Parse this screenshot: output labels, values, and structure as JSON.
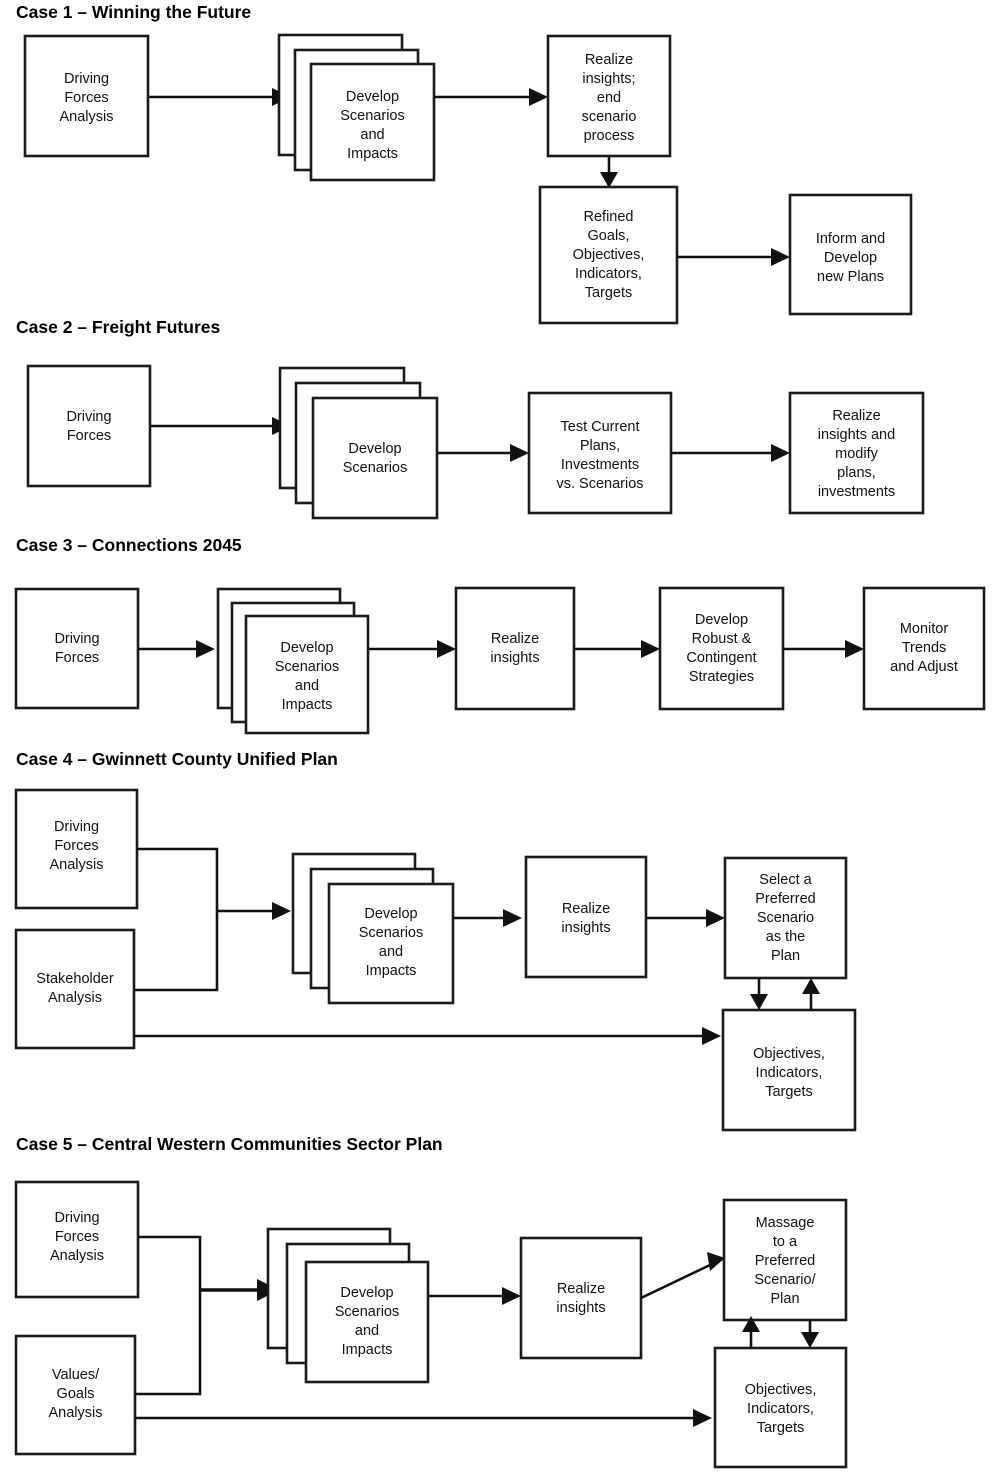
{
  "document": {
    "title": "Scenario Planning Case Process Diagrams",
    "background_color": "#ffffff",
    "line_color": "#111111"
  },
  "cases": [
    {
      "id": "case-1",
      "title": "Case 1 – Winning the Future",
      "nodes": [
        {
          "id": "c1-driving-forces-analysis",
          "label": "Driving\nForces\nAnalysis",
          "stacked": false
        },
        {
          "id": "c1-develop-scenarios-impacts",
          "label": "Develop\nScenarios\nand\nImpacts",
          "stacked": true
        },
        {
          "id": "c1-realize-insights-end",
          "label": "Realize\ninsights;\nend\nscenario\nprocess",
          "stacked": false
        },
        {
          "id": "c1-refined-goals",
          "label": "Refined\nGoals,\nObjectives,\nIndicators,\nTargets",
          "stacked": false
        },
        {
          "id": "c1-inform-develop-plans",
          "label": "Inform and\nDevelop\nnew Plans",
          "stacked": false
        }
      ],
      "edges": [
        {
          "from": "c1-driving-forces-analysis",
          "to": "c1-develop-scenarios-impacts",
          "kind": "arrow-right"
        },
        {
          "from": "c1-develop-scenarios-impacts",
          "to": "c1-realize-insights-end",
          "kind": "arrow-right"
        },
        {
          "from": "c1-realize-insights-end",
          "to": "c1-refined-goals",
          "kind": "arrow-down"
        },
        {
          "from": "c1-refined-goals",
          "to": "c1-inform-develop-plans",
          "kind": "arrow-right"
        }
      ]
    },
    {
      "id": "case-2",
      "title": "Case 2 – Freight Futures",
      "nodes": [
        {
          "id": "c2-driving-forces",
          "label": "Driving\nForces",
          "stacked": false
        },
        {
          "id": "c2-develop-scenarios",
          "label": "Develop\nScenarios",
          "stacked": true
        },
        {
          "id": "c2-test-current-plans",
          "label": "Test Current\nPlans,\nInvestments\nvs. Scenarios",
          "stacked": false
        },
        {
          "id": "c2-realize-insights-modify",
          "label": "Realize\ninsights and\nmodify\nplans,\ninvestments",
          "stacked": false
        }
      ],
      "edges": [
        {
          "from": "c2-driving-forces",
          "to": "c2-develop-scenarios",
          "kind": "arrow-right"
        },
        {
          "from": "c2-develop-scenarios",
          "to": "c2-test-current-plans",
          "kind": "arrow-right"
        },
        {
          "from": "c2-test-current-plans",
          "to": "c2-realize-insights-modify",
          "kind": "arrow-right"
        }
      ]
    },
    {
      "id": "case-3",
      "title": "Case 3 – Connections 2045",
      "nodes": [
        {
          "id": "c3-driving-forces",
          "label": "Driving\nForces",
          "stacked": false
        },
        {
          "id": "c3-develop-scenarios-impacts",
          "label": "Develop\nScenarios\nand\nImpacts",
          "stacked": true
        },
        {
          "id": "c3-realize-insights",
          "label": "Realize\ninsights",
          "stacked": false
        },
        {
          "id": "c3-develop-robust-strategies",
          "label": "Develop\nRobust &\nContingent\nStrategies",
          "stacked": false
        },
        {
          "id": "c3-monitor-trends",
          "label": "Monitor\nTrends\nand Adjust",
          "stacked": false
        }
      ],
      "edges": [
        {
          "from": "c3-driving-forces",
          "to": "c3-develop-scenarios-impacts",
          "kind": "arrow-right"
        },
        {
          "from": "c3-develop-scenarios-impacts",
          "to": "c3-realize-insights",
          "kind": "arrow-right"
        },
        {
          "from": "c3-realize-insights",
          "to": "c3-develop-robust-strategies",
          "kind": "arrow-right"
        },
        {
          "from": "c3-develop-robust-strategies",
          "to": "c3-monitor-trends",
          "kind": "arrow-right"
        }
      ]
    },
    {
      "id": "case-4",
      "title": "Case 4 – Gwinnett County Unified Plan",
      "nodes": [
        {
          "id": "c4-driving-forces-analysis",
          "label": "Driving\nForces\nAnalysis",
          "stacked": false
        },
        {
          "id": "c4-stakeholder-analysis",
          "label": "Stakeholder\nAnalysis",
          "stacked": false
        },
        {
          "id": "c4-develop-scenarios-impacts",
          "label": "Develop\nScenarios\nand\nImpacts",
          "stacked": true
        },
        {
          "id": "c4-realize-insights",
          "label": "Realize\ninsights",
          "stacked": false
        },
        {
          "id": "c4-select-preferred-scenario",
          "label": "Select a\nPreferred\nScenario\nas the\nPlan",
          "stacked": false
        },
        {
          "id": "c4-objectives-indicators-targets",
          "label": "Objectives,\nIndicators,\nTargets",
          "stacked": false
        }
      ],
      "edges": [
        {
          "from": "c4-driving-forces-analysis",
          "to": "c4-develop-scenarios-impacts",
          "kind": "elbow-merge-arrow-right"
        },
        {
          "from": "c4-stakeholder-analysis",
          "to": "c4-develop-scenarios-impacts",
          "kind": "elbow-merge-arrow-right"
        },
        {
          "from": "c4-develop-scenarios-impacts",
          "to": "c4-realize-insights",
          "kind": "arrow-right"
        },
        {
          "from": "c4-realize-insights",
          "to": "c4-select-preferred-scenario",
          "kind": "arrow-right"
        },
        {
          "from": "c4-select-preferred-scenario",
          "to": "c4-objectives-indicators-targets",
          "kind": "arrow-down"
        },
        {
          "from": "c4-objectives-indicators-targets",
          "to": "c4-select-preferred-scenario",
          "kind": "arrow-up"
        },
        {
          "from": "c4-stakeholder-analysis",
          "to": "c4-objectives-indicators-targets",
          "kind": "arrow-right-long"
        }
      ]
    },
    {
      "id": "case-5",
      "title": "Case 5 – Central Western Communities Sector Plan",
      "nodes": [
        {
          "id": "c5-driving-forces-analysis",
          "label": "Driving\nForces\nAnalysis",
          "stacked": false
        },
        {
          "id": "c5-values-goals-analysis",
          "label": "Values/\nGoals\nAnalysis",
          "stacked": false
        },
        {
          "id": "c5-develop-scenarios-impacts",
          "label": "Develop\nScenarios\nand\nImpacts",
          "stacked": true
        },
        {
          "id": "c5-realize-insights",
          "label": "Realize\ninsights",
          "stacked": false
        },
        {
          "id": "c5-massage-preferred-scenario",
          "label": "Massage\nto a\nPreferred\nScenario/\nPlan",
          "stacked": false
        },
        {
          "id": "c5-objectives-indicators-targets",
          "label": "Objectives,\nIndicators,\nTargets",
          "stacked": false
        }
      ],
      "edges": [
        {
          "from": "c5-driving-forces-analysis",
          "to": "c5-develop-scenarios-impacts",
          "kind": "elbow-merge-arrow-right"
        },
        {
          "from": "c5-values-goals-analysis",
          "to": "c5-develop-scenarios-impacts",
          "kind": "elbow-merge-arrow-right"
        },
        {
          "from": "c5-develop-scenarios-impacts",
          "to": "c5-realize-insights",
          "kind": "arrow-right"
        },
        {
          "from": "c5-realize-insights",
          "to": "c5-massage-preferred-scenario",
          "kind": "arrow-diagonal-up-right"
        },
        {
          "from": "c5-massage-preferred-scenario",
          "to": "c5-objectives-indicators-targets",
          "kind": "arrow-down"
        },
        {
          "from": "c5-objectives-indicators-targets",
          "to": "c5-massage-preferred-scenario",
          "kind": "arrow-up"
        },
        {
          "from": "c5-values-goals-analysis",
          "to": "c5-objectives-indicators-targets",
          "kind": "arrow-right-long"
        }
      ]
    }
  ],
  "labels": {
    "c1_title": "Case 1 – Winning the Future",
    "c1_n1": "Driving",
    "c1_n1b": "Forces",
    "c1_n1c": "Analysis",
    "c1_n2": "Develop",
    "c1_n2b": "Scenarios",
    "c1_n2c": "and",
    "c1_n2d": "Impacts",
    "c1_n3": "Realize",
    "c1_n3b": "insights;",
    "c1_n3c": "end",
    "c1_n3d": "scenario",
    "c1_n3e": "process",
    "c1_n4": "Refined",
    "c1_n4b": "Goals,",
    "c1_n4c": "Objectives,",
    "c1_n4d": "Indicators,",
    "c1_n4e": "Targets",
    "c1_n5": "Inform and",
    "c1_n5b": "Develop",
    "c1_n5c": "new Plans",
    "c2_title": "Case 2 – Freight Futures",
    "c2_n1": "Driving",
    "c2_n1b": "Forces",
    "c2_n2": "Develop",
    "c2_n2b": "Scenarios",
    "c2_n3": "Test Current",
    "c2_n3b": "Plans,",
    "c2_n3c": "Investments",
    "c2_n3d": "vs. Scenarios",
    "c2_n4": "Realize",
    "c2_n4b": "insights and",
    "c2_n4c": "modify",
    "c2_n4d": "plans,",
    "c2_n4e": "investments",
    "c3_title": "Case 3 – Connections 2045",
    "c3_n1": "Driving",
    "c3_n1b": "Forces",
    "c3_n2": "Develop",
    "c3_n2b": "Scenarios",
    "c3_n2c": "and",
    "c3_n2d": "Impacts",
    "c3_n3": "Realize",
    "c3_n3b": "insights",
    "c3_n4": "Develop",
    "c3_n4b": "Robust &",
    "c3_n4c": "Contingent",
    "c3_n4d": "Strategies",
    "c3_n5": "Monitor",
    "c3_n5b": "Trends",
    "c3_n5c": "and Adjust",
    "c4_title": "Case 4 – Gwinnett County Unified Plan",
    "c4_n1": "Driving",
    "c4_n1b": "Forces",
    "c4_n1c": "Analysis",
    "c4_n2": "Stakeholder",
    "c4_n2b": "Analysis",
    "c4_n3": "Develop",
    "c4_n3b": "Scenarios",
    "c4_n3c": "and",
    "c4_n3d": "Impacts",
    "c4_n4": "Realize",
    "c4_n4b": "insights",
    "c4_n5": "Select a",
    "c4_n5b": "Preferred",
    "c4_n5c": "Scenario",
    "c4_n5d": "as the",
    "c4_n5e": "Plan",
    "c4_n6": "Objectives,",
    "c4_n6b": "Indicators,",
    "c4_n6c": "Targets",
    "c5_title": "Case 5 – Central Western Communities Sector Plan",
    "c5_n1": "Driving",
    "c5_n1b": "Forces",
    "c5_n1c": "Analysis",
    "c5_n2": "Values/",
    "c5_n2b": "Goals",
    "c5_n2c": "Analysis",
    "c5_n3": "Develop",
    "c5_n3b": "Scenarios",
    "c5_n3c": "and",
    "c5_n3d": "Impacts",
    "c5_n4": "Realize",
    "c5_n4b": "insights",
    "c5_n5": "Massage",
    "c5_n5b": "to a",
    "c5_n5c": "Preferred",
    "c5_n5d": "Scenario/",
    "c5_n5e": "Plan",
    "c5_n6": "Objectives,",
    "c5_n6b": "Indicators,",
    "c5_n6c": "Targets"
  }
}
